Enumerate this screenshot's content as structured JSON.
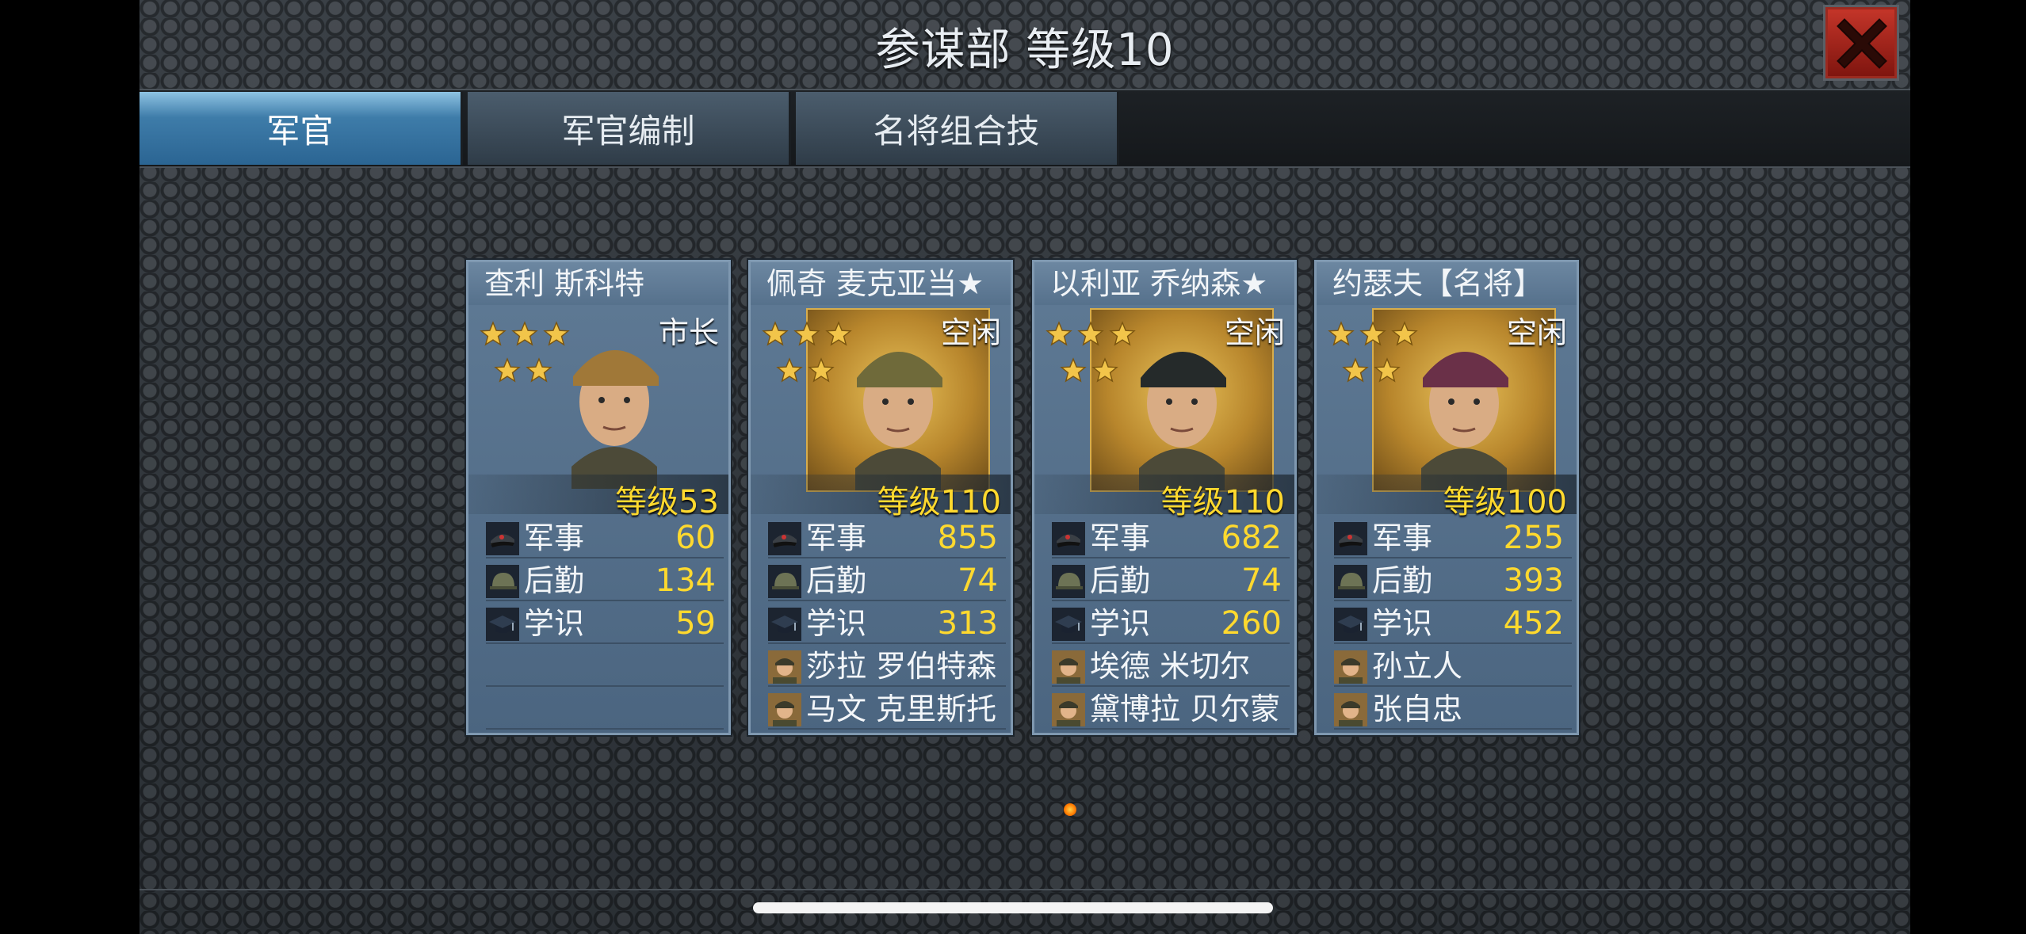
{
  "window": {
    "title": "参谋部 等级10"
  },
  "tabs": [
    {
      "label": "军官",
      "active": true
    },
    {
      "label": "军官编制",
      "active": false
    },
    {
      "label": "名将组合技",
      "active": false
    }
  ],
  "officers": [
    {
      "name": "查利 斯科特",
      "status": "市长",
      "level": "等级53",
      "stars": 5,
      "frame": "plain",
      "stats": [
        {
          "icon": "military-cap-icon",
          "label": "军事",
          "value": "60"
        },
        {
          "icon": "helmet-icon",
          "label": "后勤",
          "value": "134"
        },
        {
          "icon": "scholar-cap-icon",
          "label": "学识",
          "value": "59"
        }
      ],
      "members": []
    },
    {
      "name": "佩奇 麦克亚当★",
      "status": "空闲",
      "level": "等级110",
      "stars": 5,
      "frame": "gold",
      "stats": [
        {
          "icon": "military-cap-icon",
          "label": "军事",
          "value": "855"
        },
        {
          "icon": "helmet-icon",
          "label": "后勤",
          "value": "74"
        },
        {
          "icon": "scholar-cap-icon",
          "label": "学识",
          "value": "313"
        }
      ],
      "members": [
        "莎拉 罗伯特森",
        "马文 克里斯托"
      ]
    },
    {
      "name": "以利亚 乔纳森★",
      "status": "空闲",
      "level": "等级110",
      "stars": 5,
      "frame": "gold",
      "stats": [
        {
          "icon": "military-cap-icon",
          "label": "军事",
          "value": "682"
        },
        {
          "icon": "helmet-icon",
          "label": "后勤",
          "value": "74"
        },
        {
          "icon": "scholar-cap-icon",
          "label": "学识",
          "value": "260"
        }
      ],
      "members": [
        "埃德 米切尔",
        "黛博拉 贝尔蒙"
      ]
    },
    {
      "name": "约瑟夫【名将】",
      "status": "空闲",
      "level": "等级100",
      "stars": 5,
      "frame": "gold",
      "stats": [
        {
          "icon": "military-cap-icon",
          "label": "军事",
          "value": "255"
        },
        {
          "icon": "helmet-icon",
          "label": "后勤",
          "value": "393"
        },
        {
          "icon": "scholar-cap-icon",
          "label": "学识",
          "value": "452"
        }
      ],
      "members": [
        "孙立人",
        "张自忠"
      ]
    }
  ],
  "colors": {
    "accent_tab": "#3e7ca9",
    "value_yellow": "#ffd92e",
    "close_red": "#b32a1f"
  }
}
